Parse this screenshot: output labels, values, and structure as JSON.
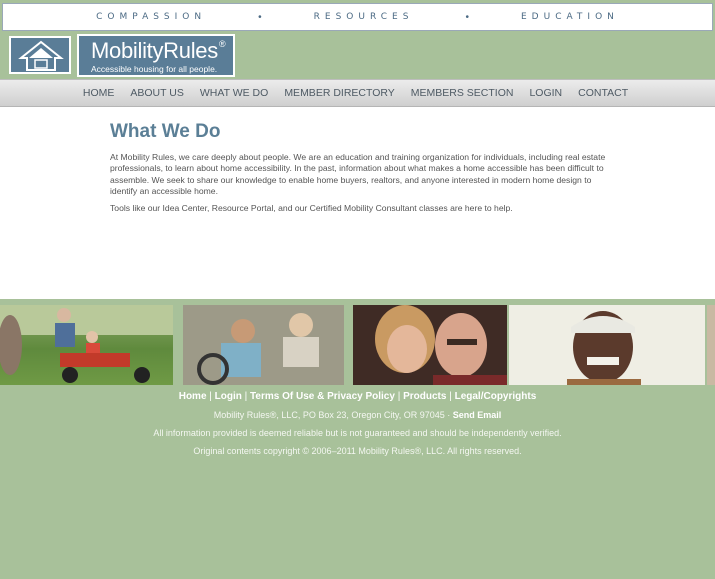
{
  "tagline": {
    "words": [
      "COMPASSION",
      "RESOURCES",
      "EDUCATION"
    ],
    "separator": "•"
  },
  "logo": {
    "name": "MobilityRules",
    "reg": "®",
    "subtitle": "Accessible housing for all people."
  },
  "nav": {
    "items": [
      "HOME",
      "ABOUT US",
      "WHAT WE DO",
      "MEMBER DIRECTORY",
      "MEMBERS SECTION",
      "LOGIN",
      "CONTACT"
    ]
  },
  "main": {
    "title": "What We Do",
    "paragraphs": [
      "At Mobility Rules, we care deeply about people. We are an education and training organization for individuals, including real estate professionals, to learn about home accessibility. In the past, information about what makes a home accessible has been difficult to assemble. We seek to share our knowledge to enable home buyers, realtors, and anyone interested in modern home design to identify an accessible home.",
      "Tools like our Idea Center, Resource Portal, and our Certified Mobility Consultant classes are here to help."
    ]
  },
  "footer": {
    "links": [
      "Home",
      "Login",
      "Terms Of Use & Privacy Policy",
      "Products",
      "Legal/Copyrights"
    ],
    "address": "Mobility Rules®, LLC, PO Box 23, Oregon City, OR 97045 · ",
    "send_email": "Send Email",
    "disclaimer": "All information provided is deemed reliable but is not guaranteed and should be independently verified.",
    "copyright": "Original contents copyright © 2006–2011 Mobility Rules®, LLC. All rights reserved."
  },
  "colors": {
    "green_bg": "#a8c19a",
    "logo_blue": "#5a7d97",
    "title_blue": "#5b7f96"
  }
}
